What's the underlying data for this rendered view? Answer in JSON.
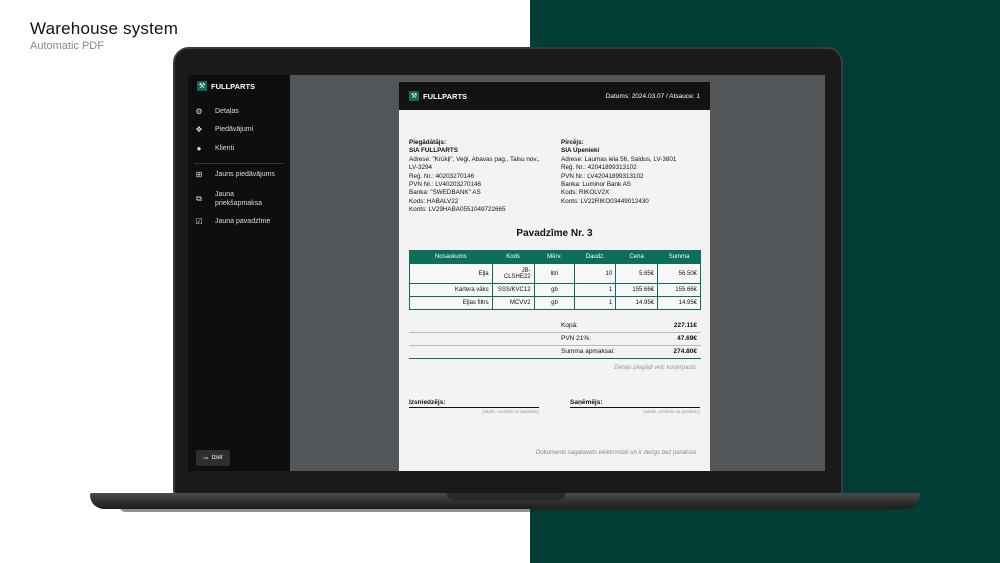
{
  "hero": {
    "title": "Warehouse system",
    "subtitle": "Automatic PDF"
  },
  "sidebar": {
    "brand": "FULLPARTS",
    "items": [
      {
        "label": "Detaļas",
        "icon": "gear-icon"
      },
      {
        "label": "Piedāvājumi",
        "icon": "handshake-icon"
      },
      {
        "label": "Klienti",
        "icon": "person-icon"
      },
      {
        "label": "Jauns piedāvājums",
        "icon": "plus-box-icon"
      },
      {
        "label": "Jauna priekšapmaksa",
        "icon": "copy-plus-icon"
      },
      {
        "label": "Jauna pavadzīme",
        "icon": "checklist-icon"
      }
    ],
    "logout": "Iziet"
  },
  "document": {
    "brand": "FULLPARTS",
    "meta": "Datums: 2024.03.07 / Atsauce: 1",
    "supplier": {
      "label": "Piegādātājs:",
      "name": "SIA FULLPARTS",
      "address_1": "Adrese: \"Krūkļi\", Veģi, Abavas pag., Talsu nov.,",
      "address_2": "LV-3294",
      "reg": "Reģ. Nr.: 40203270146",
      "pvn": "PVN Nr.: LV40203270146",
      "bank": "Banka: \"SWEDBANK\" AS",
      "code": "Kods: HABALV22",
      "account": "Konts: LV29HABA0551049722665"
    },
    "buyer": {
      "label": "Pircējs:",
      "name": "SIA Upenieki",
      "address": "Adrese: Laumas iela 56, Saldus, LV-3801",
      "reg": "Reģ. Nr.: 42041899313102",
      "pvn": "PVN Nr.: LV42041899313102",
      "bank": "Banka: Luminor Bank AS",
      "code": "Kods: RIKOLV2X",
      "account": "Konts: LV22RIKO03449012430"
    },
    "title": "Pavadzīme Nr. 3",
    "columns": [
      "Nosaukums",
      "Kods",
      "Mērv.",
      "Daudz.",
      "Cena",
      "Summa"
    ],
    "rows": [
      [
        "Eļļa",
        "JB-CLSHE22",
        "litri",
        "10",
        "5.65€",
        "56.50€"
      ],
      [
        "Kartera vāks",
        "SSS/KVC12",
        "gb",
        "1",
        "155.66€",
        "155.66€"
      ],
      [
        "Eļļas filtrs",
        "MCVV2",
        "gb",
        "1",
        "14.95€",
        "14.95€"
      ]
    ],
    "totals": {
      "sum_label": "Kopā:",
      "sum": "227.11€",
      "vat_label": "PVN 21%:",
      "vat": "47.69€",
      "grand_label": "Summa apmaksai:",
      "grand": "274.80€"
    },
    "delivery_note": "Detaļu piegādi veic kurjerpasts",
    "issuer": {
      "label": "Izsniedzējs:",
      "hint": "(vārds, uzvārds un paraksts)"
    },
    "receiver": {
      "label": "Saņēmējs:",
      "hint": "(vārds, uzvārds un paraksts)"
    },
    "footer": "Dokuments sagatavots elektroniski un ir derīgs bez paraksta"
  },
  "colors": {
    "accent": "#0d6e59",
    "dark_panel": "#003d35"
  }
}
